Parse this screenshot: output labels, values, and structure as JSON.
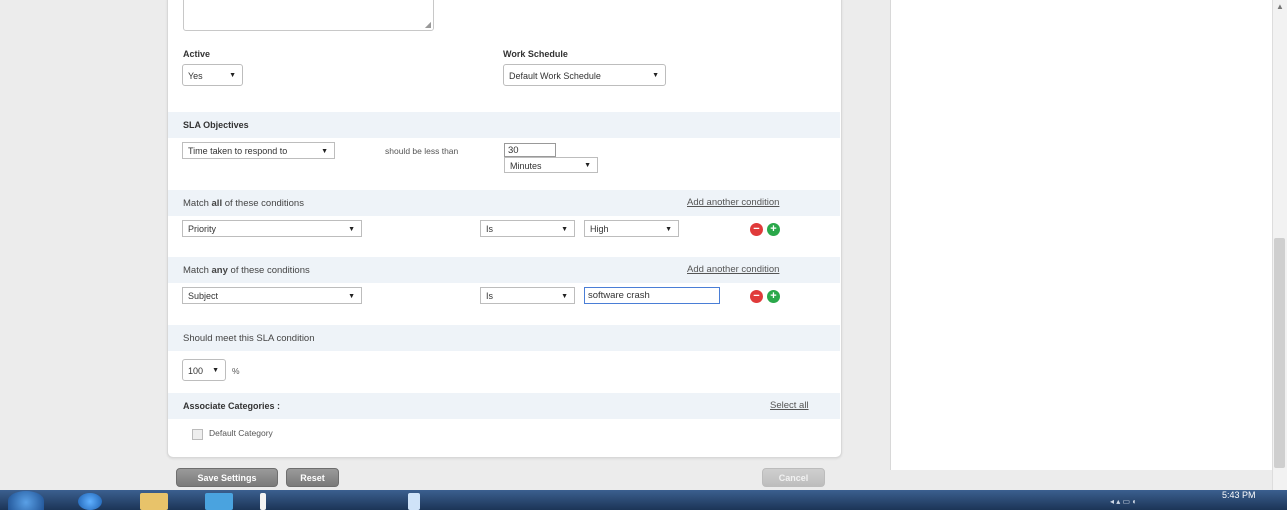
{
  "form": {
    "active_label": "Active",
    "active_value": "Yes",
    "work_schedule_label": "Work Schedule",
    "work_schedule_value": "Default Work Schedule",
    "sla_objectives_label": "SLA Objectives",
    "objective_metric": "Time taken to respond to",
    "objective_operator": "should be less than",
    "objective_value": "30",
    "objective_unit": "Minutes",
    "match_all_prefix": "Match",
    "match_all_keyword": "all",
    "match_all_suffix": "of these conditions",
    "add_condition_label": "Add another condition",
    "all_condition": {
      "field": "Priority",
      "operator": "Is",
      "value": "High"
    },
    "match_any_prefix": "Match",
    "match_any_keyword": "any",
    "match_any_suffix": "of these conditions",
    "any_condition": {
      "field": "Subject",
      "operator": "Is",
      "value": "software crash"
    },
    "should_meet_label": "Should meet this SLA condition",
    "percent_value": "100",
    "percent_sign": "%",
    "associate_categories_label": "Associate Categories :",
    "select_all_label": "Select all",
    "category_label": "Default Category"
  },
  "buttons": {
    "save": "Save Settings",
    "reset": "Reset",
    "cancel": "Cancel"
  },
  "taskbar": {
    "time": "5:43 PM"
  },
  "colors": {
    "band": "#eef3f8",
    "remove": "#e03a3a",
    "add": "#2aa84a",
    "taskbar": "#1c3557"
  }
}
